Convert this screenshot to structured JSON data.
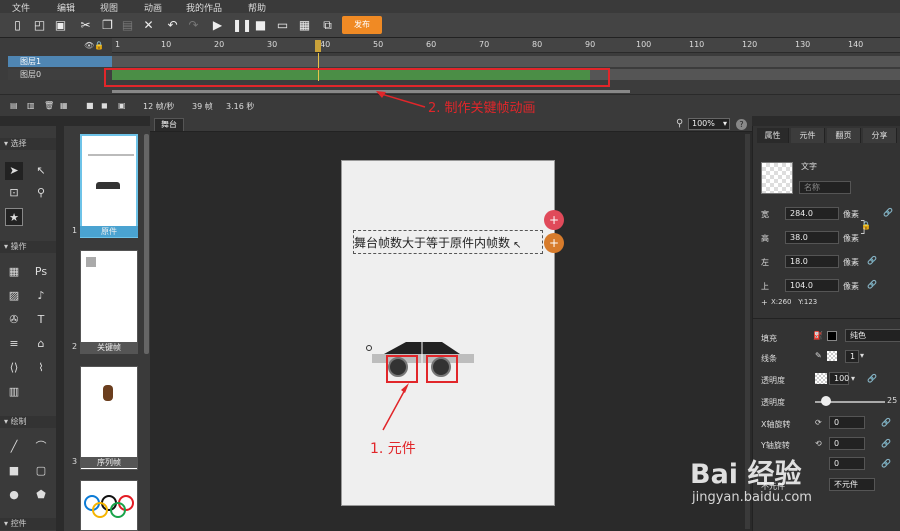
{
  "menu": [
    "文件",
    "编辑",
    "视图",
    "动画",
    "我的作品",
    "帮助"
  ],
  "toolbar": {
    "publish_label": "发布"
  },
  "timeline": {
    "ticks": [
      "1",
      "10",
      "20",
      "30",
      "40",
      "50",
      "60",
      "70",
      "80",
      "90",
      "100",
      "110",
      "120",
      "130",
      "140"
    ],
    "layers": [
      {
        "name": "图层1"
      },
      {
        "name": "图层0"
      }
    ],
    "status": {
      "fps": "12 帧/秒",
      "frames": "39 帧",
      "duration": "3.16 秒"
    }
  },
  "left_panel": {
    "select_header": "选择",
    "operate_header": "操作",
    "draw_header": "绘制",
    "more_header": "控件",
    "ps_label": "Ps"
  },
  "scenes": [
    {
      "num": "1",
      "label": "原件"
    },
    {
      "num": "2",
      "label": "关键帧"
    },
    {
      "num": "3",
      "label": "序列帧"
    }
  ],
  "stage": {
    "tab": "舞台",
    "zoom": "100%",
    "help": "?",
    "text_element": "舞台帧数大于等于原件内帧数"
  },
  "props": {
    "tabs": [
      "属性",
      "元件",
      "翻页",
      "分享"
    ],
    "type": "文字",
    "name_placeholder": "名称",
    "width_label": "宽",
    "width": "284.0",
    "height_label": "高",
    "height": "38.0",
    "left_label": "左",
    "left": "18.0",
    "top_label": "上",
    "top": "104.0",
    "unit": "像素",
    "coords": "X:260   Y:123",
    "fill_label": "填充",
    "fill_type": "纯色",
    "stroke_label": "线条",
    "stroke_width": "1",
    "opacity_label": "透明度",
    "opacity": "100",
    "blur_label": "透明度",
    "blur": "25",
    "xrot_label": "X轴旋转",
    "xrot": "0",
    "yrot_label": "Y轴旋转",
    "yrot": "0",
    "extra": "0",
    "bottom_label": "不元件",
    "bottom_value": "不元件"
  },
  "annotations": {
    "frames": "2. 制作关键帧动画",
    "component": "1. 元件"
  },
  "watermark": {
    "brand": "Bai 经验",
    "url": "jingyan.baidu.com"
  }
}
